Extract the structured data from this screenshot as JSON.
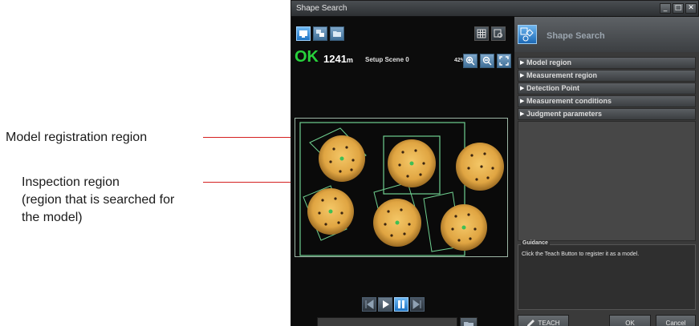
{
  "annotations": {
    "model_region": "Model registration region",
    "inspection_region_lines": [
      "Inspection region",
      "(region that is searched for",
      "the model)"
    ]
  },
  "window": {
    "title": "Shape Search",
    "controls": [
      "minimize-icon",
      "maximize-icon",
      "close-icon"
    ]
  },
  "status": {
    "judgement": "OK",
    "measure_time": "1241",
    "measure_unit": "m",
    "scene": "Setup Scene 0",
    "zoom": "42%"
  },
  "image": {
    "object_count": 6,
    "object_label": "crackers"
  },
  "panel": {
    "title": "Shape Search",
    "menu_items": [
      "Model region",
      "Measurement region",
      "Detection Point",
      "Measurement conditions",
      "Judgment parameters"
    ],
    "guidance_label": "Guidance",
    "guidance_text": "Click the Teach Button to register it as a model."
  },
  "buttons": {
    "teach": "TEACH",
    "ok": "OK",
    "cancel": "Cancel"
  },
  "colors": {
    "ok_green": "#28d23c",
    "callout_red": "#d42020",
    "region_green": "#6fcf8f"
  }
}
